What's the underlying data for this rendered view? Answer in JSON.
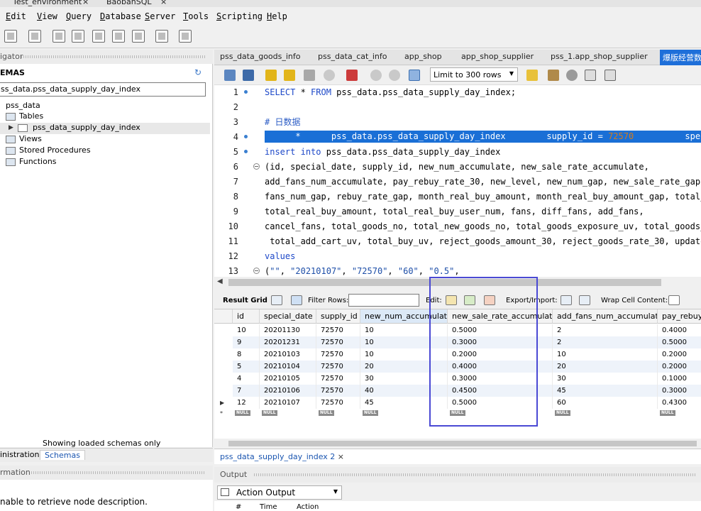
{
  "window_tabs": [
    {
      "label": "Test_environment",
      "close": "×"
    },
    {
      "label": "BaobanSQL",
      "close": "×"
    }
  ],
  "menu": [
    {
      "label_u": "E",
      "label_rest": "dit"
    },
    {
      "label_u": "V",
      "label_rest": "iew"
    },
    {
      "label_u": "Q",
      "label_rest": "uery"
    },
    {
      "label_u": "D",
      "label_rest": "atabase"
    },
    {
      "label_u": "S",
      "label_rest": "erver"
    },
    {
      "label_u": "T",
      "label_rest": "ools"
    },
    {
      "label_u": "S",
      "label_rest": "cripting"
    },
    {
      "label_u": "H",
      "label_rest": "elp"
    }
  ],
  "navigator": {
    "header": "igator",
    "schemas_title": "EMAS",
    "filter_value": "ss_data.pss_data_supply_day_index",
    "tree": {
      "schema": "pss_data",
      "tables": "Tables",
      "table_item": "pss_data_supply_day_index",
      "views": "Views",
      "procedures": "Stored Procedures",
      "functions": "Functions"
    },
    "footer": "Showing loaded schemas only"
  },
  "left_tabs": {
    "administration": "inistration",
    "schemas": "Schemas"
  },
  "info": {
    "header": "rmation",
    "message": "nable to retrieve node description."
  },
  "editor_tabs": [
    "pss_data_goods_info",
    "pss_data_cat_info",
    "app_shop",
    "app_shop_supplier",
    "pss_1.app_shop_supplier",
    "爆版经营数"
  ],
  "editor_toolbar": {
    "limit": "Limit to 300 rows"
  },
  "editor": {
    "line_numbers": [
      "1",
      "2",
      "3",
      "4",
      "5",
      "6",
      "7",
      "8",
      "9",
      "10",
      "11",
      "12",
      "13"
    ],
    "line1_kw1": "SELECT",
    "line1_mid": " * ",
    "line1_kw2": "FROM",
    "line1_rest": " pss_data.pss_data_supply_day_index;",
    "line3": "# 日数据",
    "line4_a": "      *      pss_data.pss_data_supply_day_index        supply_id = ",
    "line4_num": "72570",
    "line4_b": "          speci",
    "line5_kw1": "insert",
    "line5_kw2": "into",
    "line5_rest": " pss_data.pss_data_supply_day_index",
    "line6": "(id, special_date, supply_id, new_num_accumulate, new_sale_rate_accumulate,",
    "line7": "add_fans_num_accumulate, pay_rebuy_rate_30, new_level, new_num_gap, new_sale_rate_gap,",
    "line8": "fans_num_gap, rebuy_rate_gap, month_real_buy_amount, month_real_buy_amount_gap, total_re",
    "line9": "total_real_buy_amount, total_real_buy_user_num, fans, diff_fans, add_fans,",
    "line10": "cancel_fans, total_goods_no, total_new_goods_no, total_goods_exposure_uv, total_goods_de",
    "line11": " total_add_cart_uv, total_buy_uv, reject_goods_amount_30, reject_goods_rate_30, update_t",
    "line12": "values",
    "line13_open": "(",
    "line13_strs": [
      "\"\"",
      "\"20210107\"",
      "\"72570\"",
      "\"60\"",
      "\"0.5\""
    ],
    "line13_sep": ", "
  },
  "result_toolbar": {
    "result_grid": "Result Grid",
    "filter_rows": "Filter Rows:",
    "edit": "Edit:",
    "export_import": "Export/Import:",
    "wrap": "Wrap Cell Content:"
  },
  "grid": {
    "columns": [
      "id",
      "special_date",
      "supply_id",
      "new_num_accumulate",
      "new_sale_rate_accumulate",
      "add_fans_num_accumulate",
      "pay_rebuy_"
    ],
    "rows": [
      [
        "10",
        "20201130",
        "72570",
        "10",
        "0.5000",
        "2",
        "0.4000"
      ],
      [
        "9",
        "20201231",
        "72570",
        "10",
        "0.3000",
        "2",
        "0.5000"
      ],
      [
        "8",
        "20210103",
        "72570",
        "10",
        "0.2000",
        "10",
        "0.2000"
      ],
      [
        "5",
        "20210104",
        "72570",
        "20",
        "0.4000",
        "20",
        "0.2000"
      ],
      [
        "4",
        "20210105",
        "72570",
        "30",
        "0.3000",
        "30",
        "0.1000"
      ],
      [
        "7",
        "20210106",
        "72570",
        "40",
        "0.4500",
        "45",
        "0.3000"
      ],
      [
        "12",
        "20210107",
        "72570",
        "45",
        "0.5000",
        "60",
        "0.4300"
      ]
    ],
    "null_label": "NULL",
    "new_row_marker": "*"
  },
  "result_tab": {
    "label": "pss_data_supply_day_index 2",
    "close": "×"
  },
  "output": {
    "header": "Output",
    "selector": "Action Output",
    "col_num": "#",
    "col_time": "Time",
    "col_action": "Action"
  },
  "colors": {
    "accent": "#1e6fd9",
    "highlight_box": "#4a49d4",
    "keyword": "#1d48c8",
    "number": "#d27b1d"
  }
}
